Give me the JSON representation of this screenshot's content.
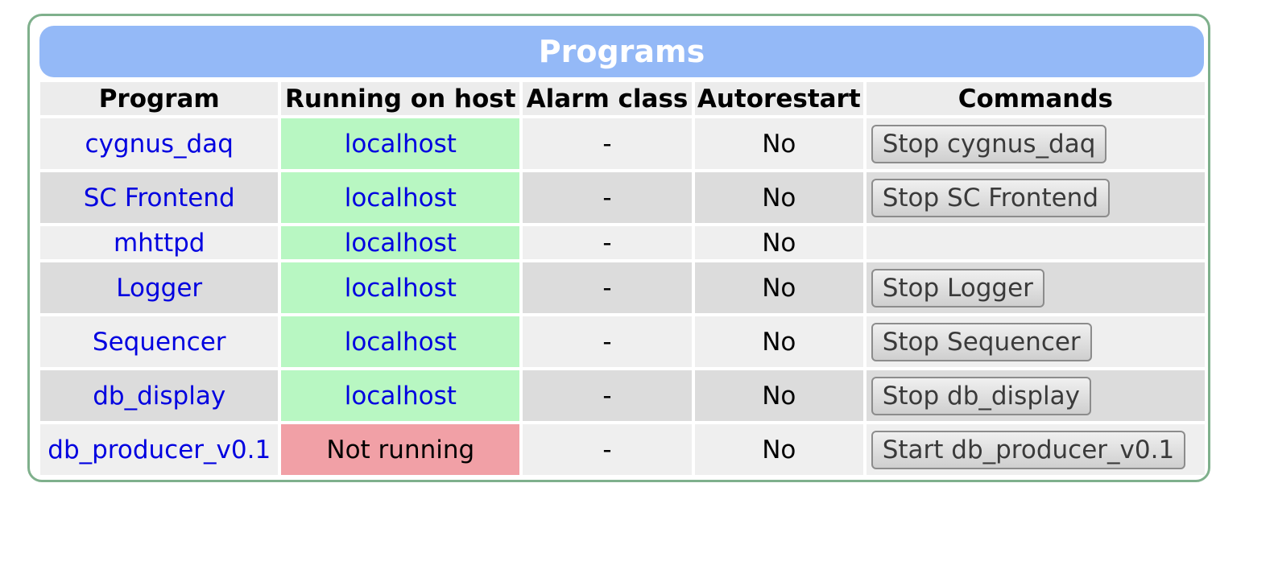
{
  "panel": {
    "title": "Programs"
  },
  "table": {
    "headers": [
      "Program",
      "Running on host",
      "Alarm class",
      "Autorestart",
      "Commands"
    ],
    "rows": [
      {
        "program": "cygnus_daq",
        "host": "localhost",
        "running": true,
        "alarm_class": "-",
        "autorestart": "No",
        "command": "Stop cygnus_daq"
      },
      {
        "program": "SC Frontend",
        "host": "localhost",
        "running": true,
        "alarm_class": "-",
        "autorestart": "No",
        "command": "Stop SC Frontend"
      },
      {
        "program": "mhttpd",
        "host": "localhost",
        "running": true,
        "alarm_class": "-",
        "autorestart": "No",
        "command": ""
      },
      {
        "program": "Logger",
        "host": "localhost",
        "running": true,
        "alarm_class": "-",
        "autorestart": "No",
        "command": "Stop Logger"
      },
      {
        "program": "Sequencer",
        "host": "localhost",
        "running": true,
        "alarm_class": "-",
        "autorestart": "No",
        "command": "Stop Sequencer"
      },
      {
        "program": "db_display",
        "host": "localhost",
        "running": true,
        "alarm_class": "-",
        "autorestart": "No",
        "command": "Stop db_display"
      },
      {
        "program": "db_producer_v0.1",
        "host": "Not running",
        "running": false,
        "alarm_class": "-",
        "autorestart": "No",
        "command": "Start db_producer_v0.1"
      }
    ]
  },
  "colors": {
    "title_bar": "#94b9f7",
    "frame_border": "#7fb08c",
    "running_host": "#b8f7c2",
    "not_running_host": "#f1a0a6",
    "link_text": "#0000e0"
  }
}
